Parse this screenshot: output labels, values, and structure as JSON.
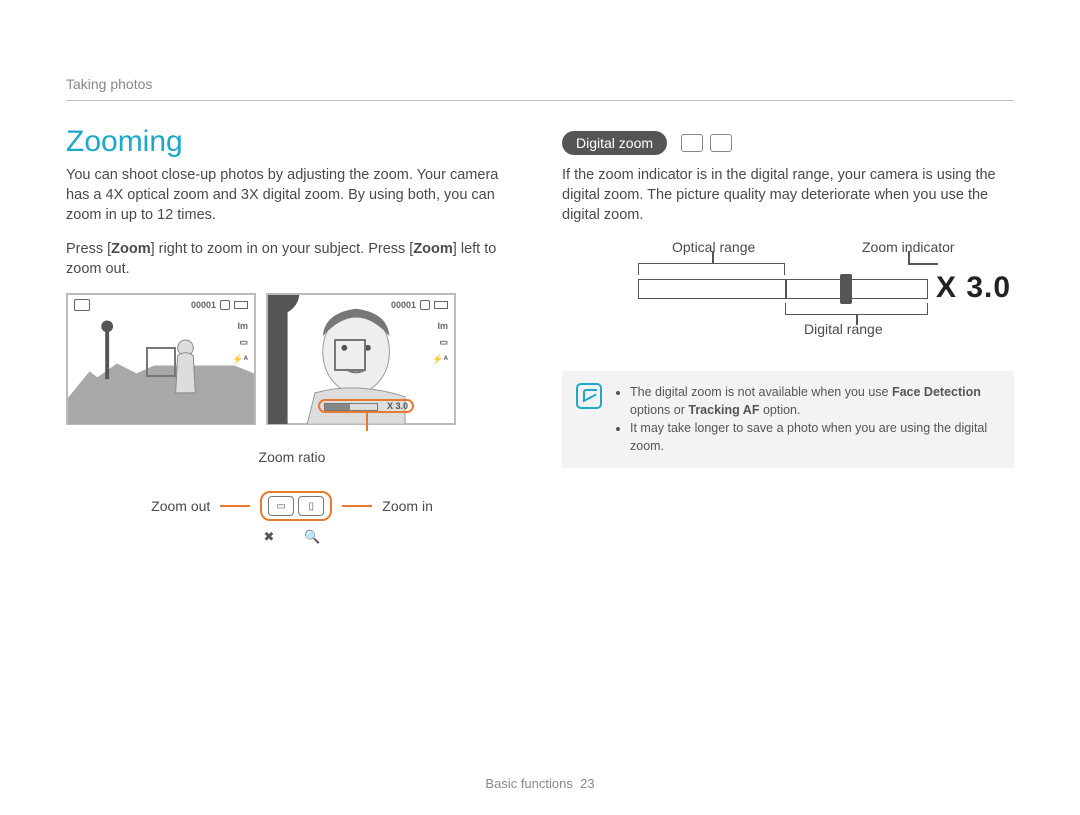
{
  "breadcrumb": "Taking photos",
  "left": {
    "heading": "Zooming",
    "intro": "You can shoot close-up photos by adjusting the zoom. Your camera has a 4X optical zoom and 3X digital zoom. By using both, you can zoom in up to 12 times.",
    "press_line_1": "Press [",
    "zoom_word": "Zoom",
    "press_line_2": "] right to zoom in on your subject. Press [",
    "press_line_3": "] left to zoom out.",
    "screen_count": "00001",
    "side_labels": [
      "Im",
      "▭",
      "⚡ᴬ"
    ],
    "zoombar_text": "X 3.0",
    "zoom_ratio_label": "Zoom ratio",
    "zoom_out_label": "Zoom out",
    "zoom_in_label": "Zoom in",
    "symbol_out": "✖",
    "symbol_in": "🔍"
  },
  "right": {
    "pill": "Digital zoom",
    "desc": "If the zoom indicator is in the digital range, your camera is using the digital zoom. The picture quality may deteriorate when you use the digital zoom.",
    "label_optical": "Optical range",
    "label_indicator": "Zoom indicator",
    "label_digital": "Digital range",
    "zoom_value": "X 3.0",
    "note_items": [
      {
        "pre": "The digital zoom is not available when you use ",
        "b1": "Face Detection",
        "mid": " options or ",
        "b2": "Tracking AF",
        "post": " option."
      },
      {
        "text": "It may take longer to save a photo when you are using the digital zoom."
      }
    ]
  },
  "footer": {
    "section": "Basic functions",
    "page": "23"
  }
}
